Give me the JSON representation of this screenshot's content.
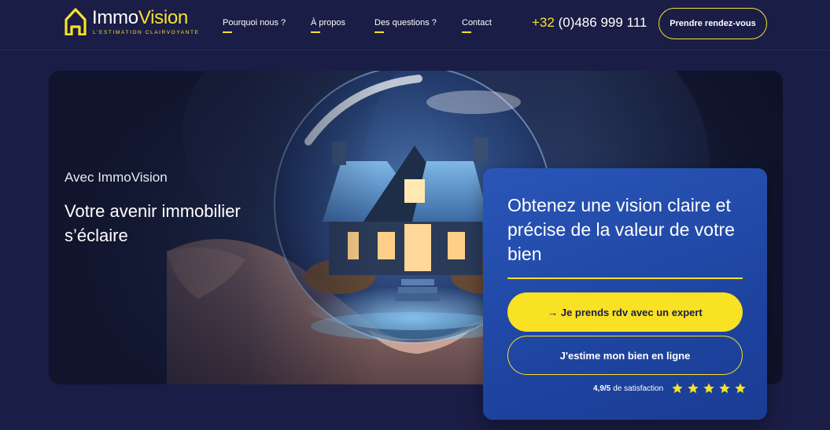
{
  "header": {
    "logo": {
      "name_start": "Immo",
      "name_end": "Vision",
      "tagline": "L'ESTIMATION CLAIRVOYANTE",
      "icon": "house-logo-icon"
    },
    "nav": [
      {
        "label": "Pourquoi nous ?"
      },
      {
        "label": "À propos"
      },
      {
        "label": "Des questions ?"
      },
      {
        "label": "Contact"
      }
    ],
    "phone": {
      "prefix": "+32",
      "number": "(0)486 999 111"
    },
    "cta_label": "Prendre rendez-vous"
  },
  "hero": {
    "eyebrow": "Avec ImmoVision",
    "title": "Votre avenir immobilier s’éclaire",
    "image": "crystal-ball-house-image"
  },
  "card": {
    "title": "Obtenez une vision claire et précise de la valeur de votre bien",
    "primary_button": "→ Je prends rdv avec un expert",
    "secondary_button": "J'estime mon bien en ligne",
    "rating_score": "4,9/5",
    "rating_text": "de satisfaction",
    "stars": 5
  },
  "colors": {
    "background": "#1a1d45",
    "accent_yellow": "#f7e12a",
    "card_blue": "#2350b0"
  }
}
